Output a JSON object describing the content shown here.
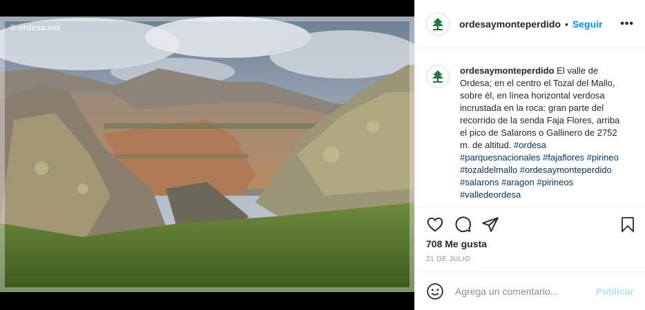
{
  "photo": {
    "watermark": "© ordesa.net"
  },
  "post_header": {
    "username": "ordesaymonteperdido",
    "separator": "•",
    "follow_label": "Seguir",
    "more_label": "•••",
    "avatar_icon": "tree-logo-icon"
  },
  "caption": {
    "username": "ordesaymonteperdido",
    "text": " El valle de Ordesa; en el centro el Tozal del Mallo, sobre él, en línea horizontal verdosa incrustada en la roca: gran parte del recorrido de la senda Faja Flores, arriba el pico de Salarons o Gallinero de 2752 m. de altitud. ",
    "hashtags": [
      "#ordesa",
      "#parquesnacionales",
      "#fajaflores",
      "#pirineo",
      "#tozaldelmallo",
      "#ordesaymonteperdido",
      "#salarons",
      "#aragon",
      "#pirineos",
      "#valledeordesa"
    ]
  },
  "actions": {
    "like_icon": "heart-icon",
    "comment_icon": "comment-bubble-icon",
    "share_icon": "paper-plane-icon",
    "save_icon": "bookmark-icon"
  },
  "likes_text": "708 Me gusta",
  "date_text": "21 DE JULIO",
  "comment_box": {
    "emoji_icon": "smiley-icon",
    "placeholder": "Agrega un comentario...",
    "post_label": "Publicar"
  },
  "colors": {
    "link_blue": "#0095f6",
    "hashtag_blue": "#00376b",
    "post_disabled": "#b2dffc",
    "muted": "#8e8e8e"
  }
}
